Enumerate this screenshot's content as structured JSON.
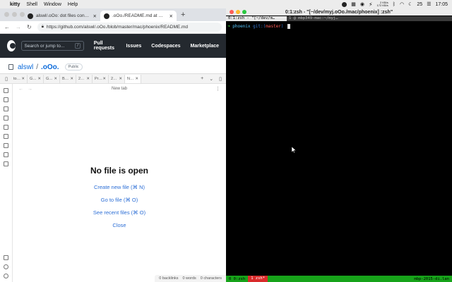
{
  "menubar": {
    "app": "kitty",
    "items": [
      "Shell",
      "Window",
      "Help"
    ],
    "net_up": "2 KB/s",
    "net_down": "172 KB/s",
    "battery": "25",
    "clock": "17:05"
  },
  "chrome": {
    "tabs": [
      {
        "label": "alswl/.oOo: dot files configure",
        "active": false
      },
      {
        "label": ".oOo./README.md at master",
        "active": true
      }
    ],
    "url": "https://github.com/alswl/.oOo./blob/master/mac/phoenix/README.md"
  },
  "github": {
    "search_placeholder": "Search or jump to...",
    "search_key": "/",
    "nav": [
      "Pull requests",
      "Issues",
      "Codespaces",
      "Marketplace"
    ],
    "owner": "alswl",
    "repo": ".oOo.",
    "visibility": "Public"
  },
  "obsidian": {
    "tabs": [
      "to…",
      "G…",
      "G…",
      "B…",
      "2…",
      "Pr…",
      "2…",
      "N…"
    ],
    "view_title": "New tab",
    "empty_heading": "No file is open",
    "actions": [
      "Create new file (⌘ N)",
      "Go to file (⌘ O)",
      "See recent files (⌘ O)",
      "Close"
    ],
    "status": [
      "0 backlinks",
      "0 words",
      "0 characters"
    ]
  },
  "terminal": {
    "window_title": "0:1:zsh - \"[~/dev/myj.oOo./mac/phoenix] :zsh\"",
    "tab_active": "0:1:zsh - \"[~/dev/m…",
    "tab_other": "1 @ mbp349-mac:~/myj…",
    "prompt_dir": "phoenix",
    "prompt_git": "git:(",
    "prompt_branch": "master",
    "prompt_git_close": ")",
    "tmux_window0": "0 0:zsh",
    "tmux_window1": "1 zsh*",
    "tmux_host": "mbp-2015-di.lan"
  }
}
